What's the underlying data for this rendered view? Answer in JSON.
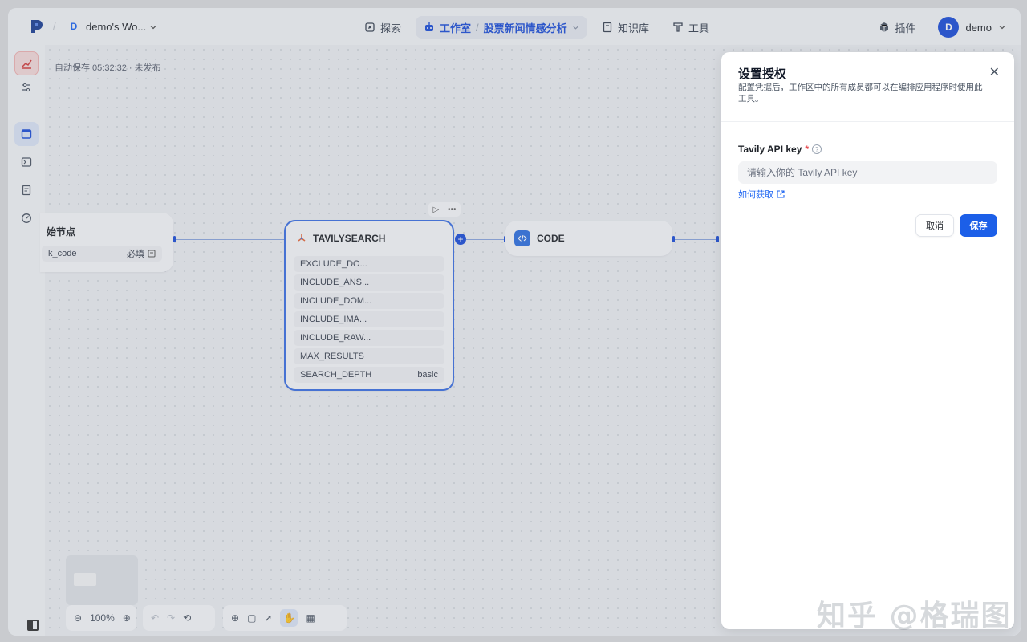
{
  "header": {
    "workspace_badge": "D",
    "workspace_name": "demo's Wo...",
    "nav": {
      "explore": "探索",
      "studio": "工作室",
      "app_name": "股票新闻情感分析",
      "knowledge": "知识库",
      "tools": "工具"
    },
    "plugins": "插件",
    "user_initial": "D",
    "user_name": "demo"
  },
  "canvas": {
    "autosave": "自动保存 05:32:32 · 未发布",
    "start_node": {
      "title": "始节点",
      "field_name": "k_code",
      "field_flag": "必填"
    },
    "tavily_node": {
      "title": "TAVILYSEARCH",
      "fields": [
        {
          "name": "EXCLUDE_DO...",
          "value": ""
        },
        {
          "name": "INCLUDE_ANS...",
          "value": ""
        },
        {
          "name": "INCLUDE_DOM...",
          "value": ""
        },
        {
          "name": "INCLUDE_IMA...",
          "value": ""
        },
        {
          "name": "INCLUDE_RAW...",
          "value": ""
        },
        {
          "name": "MAX_RESULTS",
          "value": ""
        },
        {
          "name": "SEARCH_DEPTH",
          "value": "basic"
        }
      ]
    },
    "code_node": {
      "title": "CODE"
    },
    "zoom": "100%"
  },
  "dialog": {
    "title": "设置授权",
    "description": "配置凭据后，工作区中的所有成员都可以在编排应用程序时使用此工具。",
    "field_label": "Tavily API key",
    "required_mark": "*",
    "input_placeholder": "请输入你的 Tavily API key",
    "input_value": "",
    "help_link": "如何获取",
    "cancel": "取消",
    "save": "保存"
  },
  "watermark": "知乎 @格瑞图",
  "colors": {
    "accent": "#1c5fe8",
    "danger": "#e5484d",
    "selected_node_border": "#3b6fe3"
  }
}
